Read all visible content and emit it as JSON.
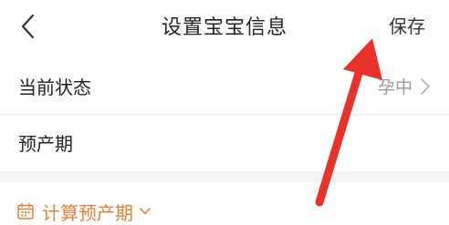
{
  "header": {
    "back_icon": "chevron-left-icon",
    "title": "设置宝宝信息",
    "save_label": "保存"
  },
  "rows": [
    {
      "label": "当前状态",
      "value": "孕中",
      "icon": "chevron-right-icon"
    },
    {
      "label": "预产期"
    }
  ],
  "calculate": {
    "icon": "calendar-icon",
    "label": "计算预产期",
    "dropdown_icon": "chevron-down-icon"
  },
  "annotation": {
    "icon": "red-arrow-icon",
    "color": "#e8322a"
  },
  "colors": {
    "accent": "#e8813a",
    "text": "#222222",
    "muted": "#9a9a9a"
  }
}
